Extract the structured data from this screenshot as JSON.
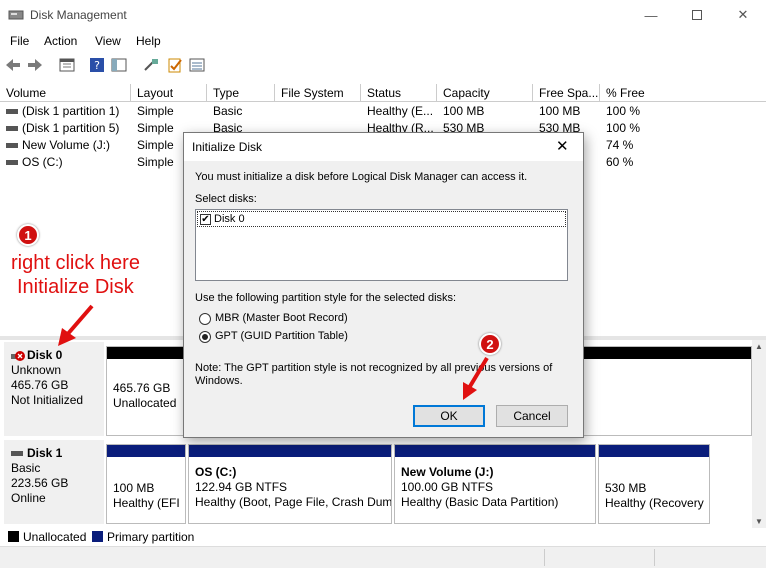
{
  "window": {
    "title": "Disk Management",
    "icon": "disk-management-icon"
  },
  "menu": [
    "File",
    "Action",
    "View",
    "Help"
  ],
  "toolbar_icons": [
    "back-arrow-icon",
    "forward-arrow-icon",
    "properties-icon",
    "help-icon",
    "console-tree-icon",
    "connect-icon",
    "check-icon",
    "list-icon"
  ],
  "table": {
    "headers": [
      "Volume",
      "Layout",
      "Type",
      "File System",
      "Status",
      "Capacity",
      "Free Spa...",
      "% Free"
    ],
    "rows": [
      [
        "(Disk 1 partition 1)",
        "Simple",
        "Basic",
        "",
        "Healthy (E...",
        "100 MB",
        "100 MB",
        "100 %"
      ],
      [
        "(Disk 1 partition 5)",
        "Simple",
        "Basic",
        "",
        "Healthy (R...",
        "530 MB",
        "530 MB",
        "100 %"
      ],
      [
        "New Volume (J:)",
        "Simple",
        "",
        "",
        "",
        "",
        "",
        "74 %"
      ],
      [
        "OS (C:)",
        "Simple",
        "",
        "",
        "",
        "",
        "",
        "60 %"
      ]
    ]
  },
  "disk0": {
    "name": "Disk 0",
    "type": "Unknown",
    "size": "465.76 GB",
    "state": "Not Initialized",
    "part_size": "465.76 GB",
    "part_status": "Unallocated"
  },
  "disk1": {
    "name": "Disk 1",
    "type": "Basic",
    "size": "223.56 GB",
    "state": "Online",
    "partitions": [
      {
        "name": "",
        "size": "100 MB",
        "status": "Healthy (EFI"
      },
      {
        "name": "OS  (C:)",
        "size": "122.94 GB NTFS",
        "status": "Healthy (Boot, Page File, Crash Dum"
      },
      {
        "name": "New Volume  (J:)",
        "size": "100.00 GB NTFS",
        "status": "Healthy (Basic Data Partition)"
      },
      {
        "name": "",
        "size": "530 MB",
        "status": "Healthy (Recovery"
      }
    ]
  },
  "legend": {
    "unallocated": "Unallocated",
    "primary": "Primary partition"
  },
  "dialog": {
    "title": "Initialize Disk",
    "intro": "You must initialize a disk before Logical Disk Manager can access it.",
    "select_label": "Select disks:",
    "disk_item": "Disk 0",
    "style_label": "Use the following partition style for the selected disks:",
    "mbr": "MBR (Master Boot Record)",
    "gpt": "GPT (GUID Partition Table)",
    "selected_style": "GPT",
    "note": "Note: The GPT partition style is not recognized by all previous versions of Windows.",
    "ok": "OK",
    "cancel": "Cancel"
  },
  "annotations": {
    "step1": "1",
    "step1_line1": "right click here",
    "step1_line2": "Initialize Disk",
    "step2": "2",
    "color": "#e01010"
  }
}
